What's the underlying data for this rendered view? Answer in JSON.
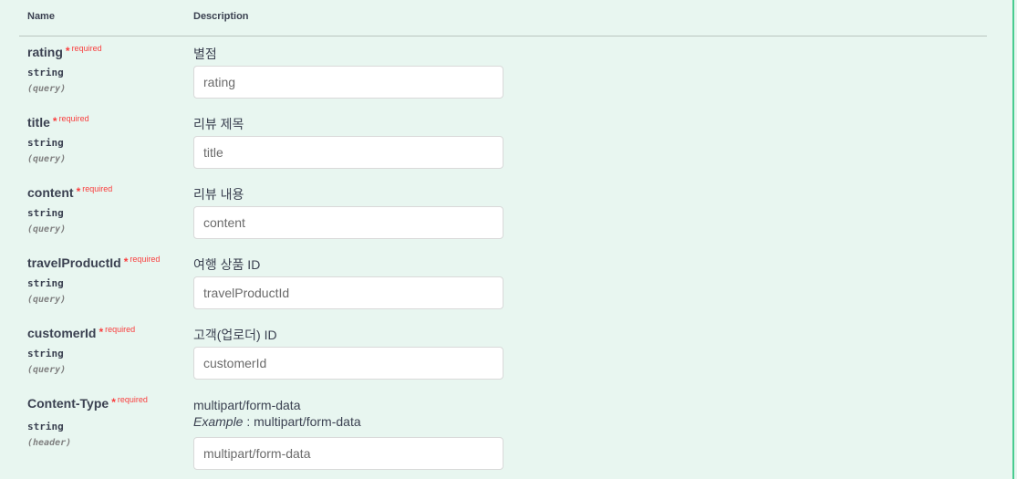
{
  "header": {
    "name_label": "Name",
    "description_label": "Description"
  },
  "required_star": "*",
  "required_label": "required",
  "params": [
    {
      "name": "rating",
      "type": "string",
      "in": "(query)",
      "description": "별점",
      "placeholder": "rating"
    },
    {
      "name": "title",
      "type": "string",
      "in": "(query)",
      "description": "리뷰 제목",
      "placeholder": "title"
    },
    {
      "name": "content",
      "type": "string",
      "in": "(query)",
      "description": "리뷰 내용",
      "placeholder": "content"
    },
    {
      "name": "travelProductId",
      "type": "string",
      "in": "(query)",
      "description": "여행 상품 ID",
      "placeholder": "travelProductId"
    },
    {
      "name": "customerId",
      "type": "string",
      "in": "(query)",
      "description": "고객(업로더) ID",
      "placeholder": "customerId"
    },
    {
      "name": "Content-Type",
      "type": "string",
      "in": "(header)",
      "description": "multipart/form-data",
      "example_label": "Example",
      "example_value": ": multipart/form-data",
      "placeholder": "multipart/form-data"
    }
  ]
}
